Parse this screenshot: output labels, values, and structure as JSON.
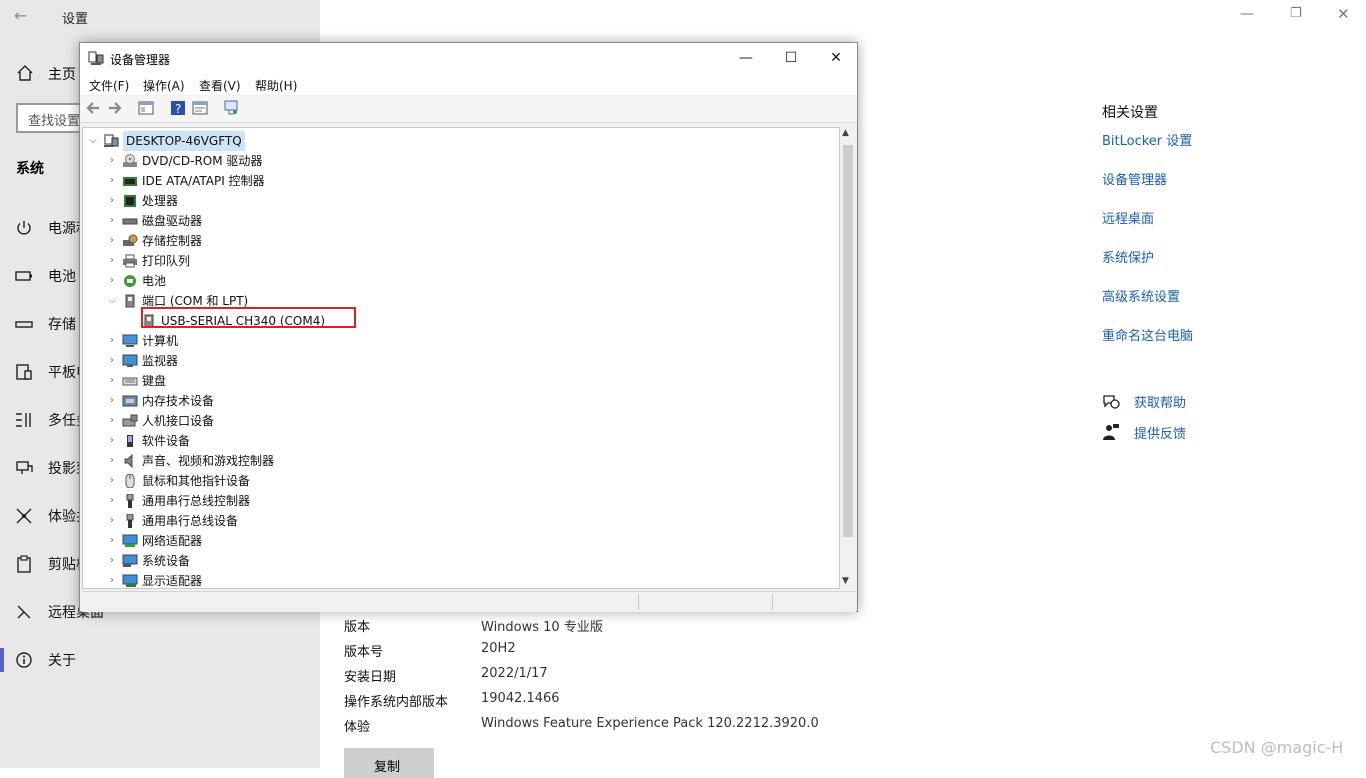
{
  "settings": {
    "title": "设置",
    "home_label": "主页",
    "search_placeholder": "查找设置",
    "system_heading": "系统",
    "nav_items": [
      {
        "label": "电源和睡眠",
        "icon": "power-icon"
      },
      {
        "label": "电池",
        "icon": "battery-icon"
      },
      {
        "label": "存储",
        "icon": "storage-icon"
      },
      {
        "label": "平板电脑",
        "icon": "tablet-icon"
      },
      {
        "label": "多任务处理",
        "icon": "multitask-icon"
      },
      {
        "label": "投影到此电脑",
        "icon": "project-icon"
      },
      {
        "label": "体验共享",
        "icon": "share-icon"
      },
      {
        "label": "剪贴板",
        "icon": "clipboard-icon"
      },
      {
        "label": "远程桌面",
        "icon": "remote-desktop-icon"
      },
      {
        "label": "关于",
        "icon": "info-icon"
      }
    ],
    "related": {
      "heading": "相关设置",
      "links": [
        "BitLocker 设置",
        "设备管理器",
        "远程桌面",
        "系统保护",
        "高级系统设置",
        "重命名这台电脑"
      ]
    },
    "help": [
      {
        "label": "获取帮助",
        "icon": "help-icon"
      },
      {
        "label": "提供反馈",
        "icon": "feedback-icon"
      }
    ],
    "specs": [
      {
        "label": "版本",
        "value": "Windows 10 专业版"
      },
      {
        "label": "版本号",
        "value": "20H2"
      },
      {
        "label": "安装日期",
        "value": "2022/1/17"
      },
      {
        "label": "操作系统内部版本",
        "value": "19042.1466"
      },
      {
        "label": "体验",
        "value": "Windows Feature Experience Pack 120.2212.3920.0"
      }
    ],
    "copy_label": "复制",
    "watermark": "CSDN @magic-H"
  },
  "device_manager": {
    "title": "设备管理器",
    "window_buttons": {
      "minimize": "—",
      "maximize": "☐",
      "close": "✕"
    },
    "menu": [
      "文件(F)",
      "操作(A)",
      "查看(V)",
      "帮助(H)"
    ],
    "root": "DESKTOP-46VGFTQ",
    "tree": [
      {
        "label": "DVD/CD-ROM 驱动器",
        "icon": "dvd-drive-icon",
        "expanded": false
      },
      {
        "label": "IDE ATA/ATAPI 控制器",
        "icon": "ide-controller-icon",
        "expanded": false
      },
      {
        "label": "处理器",
        "icon": "processor-icon",
        "expanded": false
      },
      {
        "label": "磁盘驱动器",
        "icon": "disk-drive-icon",
        "expanded": false
      },
      {
        "label": "存储控制器",
        "icon": "storage-controller-icon",
        "expanded": false
      },
      {
        "label": "打印队列",
        "icon": "printer-icon",
        "expanded": false
      },
      {
        "label": "电池",
        "icon": "battery-icon",
        "expanded": false
      },
      {
        "label": "端口 (COM 和 LPT)",
        "icon": "port-icon",
        "expanded": true
      },
      {
        "label": "USB-SERIAL CH340 (COM4)",
        "icon": "port-icon",
        "child": true,
        "highlighted": true
      },
      {
        "label": "计算机",
        "icon": "computer-icon",
        "expanded": false
      },
      {
        "label": "监视器",
        "icon": "monitor-icon",
        "expanded": false
      },
      {
        "label": "键盘",
        "icon": "keyboard-icon",
        "expanded": false
      },
      {
        "label": "内存技术设备",
        "icon": "memory-device-icon",
        "expanded": false
      },
      {
        "label": "人机接口设备",
        "icon": "hid-icon",
        "expanded": false
      },
      {
        "label": "软件设备",
        "icon": "software-device-icon",
        "expanded": false
      },
      {
        "label": "声音、视频和游戏控制器",
        "icon": "sound-icon",
        "expanded": false
      },
      {
        "label": "鼠标和其他指针设备",
        "icon": "mouse-icon",
        "expanded": false
      },
      {
        "label": "通用串行总线控制器",
        "icon": "usb-icon",
        "expanded": false
      },
      {
        "label": "通用串行总线设备",
        "icon": "usb-icon",
        "expanded": false
      },
      {
        "label": "网络适配器",
        "icon": "network-adapter-icon",
        "expanded": false
      },
      {
        "label": "系统设备",
        "icon": "system-device-icon",
        "expanded": false
      },
      {
        "label": "显示适配器",
        "icon": "display-adapter-icon",
        "expanded": false
      }
    ],
    "colors": {
      "highlight_box": "#e02020",
      "root_selection": "#cce4f7"
    }
  }
}
